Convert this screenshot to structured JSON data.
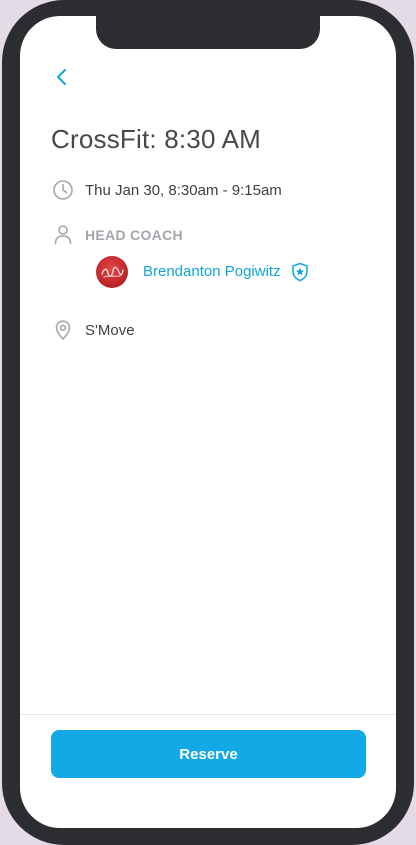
{
  "header": {
    "back_icon": "chevron-left-icon"
  },
  "class_info": {
    "title": "CrossFit: 8:30 AM",
    "datetime": "Thu Jan 30, 8:30am - 9:15am",
    "datetime_icon": "clock-icon",
    "coach_heading": "HEAD COACH",
    "coach_icon": "person-icon",
    "coach_name": "Brendanton Pogiwitz",
    "coach_badge_icon": "shield-star-icon",
    "location": "S'Move",
    "location_icon": "map-pin-icon"
  },
  "footer": {
    "reserve_label": "Reserve"
  },
  "colors": {
    "accent": "#12a9e6",
    "link": "#12a5dc",
    "frame": "#2b2d31",
    "muted": "#a3a6ab",
    "text": "#3d4045"
  }
}
